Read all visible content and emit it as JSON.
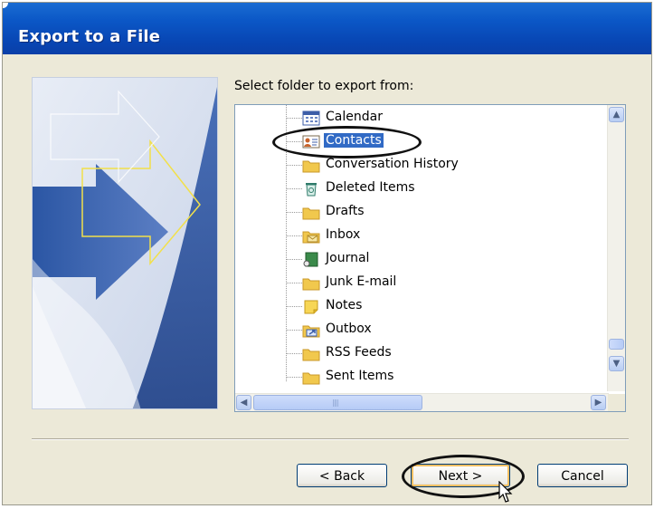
{
  "window": {
    "title": "Export to a File"
  },
  "prompt": "Select folder to export from:",
  "folders": [
    {
      "label": "Calendar",
      "icon": "calendar-icon"
    },
    {
      "label": "Contacts",
      "icon": "contacts-icon",
      "selected": true
    },
    {
      "label": "Conversation History",
      "icon": "folder-icon"
    },
    {
      "label": "Deleted Items",
      "icon": "deleted-items-icon"
    },
    {
      "label": "Drafts",
      "icon": "folder-icon"
    },
    {
      "label": "Inbox",
      "icon": "inbox-icon"
    },
    {
      "label": "Journal",
      "icon": "journal-icon"
    },
    {
      "label": "Junk E-mail",
      "icon": "folder-icon"
    },
    {
      "label": "Notes",
      "icon": "notes-icon"
    },
    {
      "label": "Outbox",
      "icon": "outbox-icon"
    },
    {
      "label": "RSS Feeds",
      "icon": "folder-icon"
    },
    {
      "label": "Sent Items",
      "icon": "folder-icon"
    }
  ],
  "buttons": {
    "back": "< Back",
    "next": "Next >",
    "cancel": "Cancel"
  },
  "colors": {
    "title_bar": "#0a52c6",
    "selection": "#316ac5",
    "dialog_bg": "#ece9d8"
  }
}
